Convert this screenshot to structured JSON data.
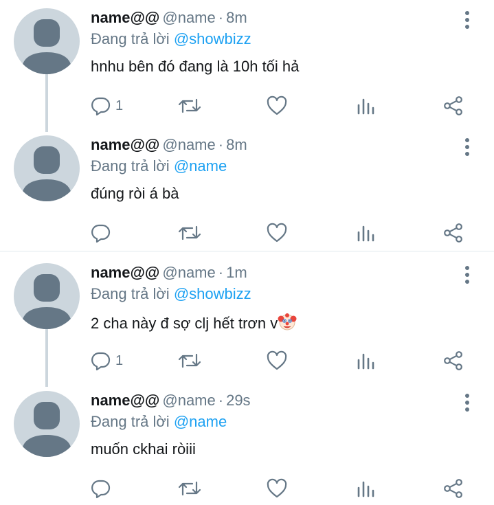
{
  "tweets": [
    {
      "name": "name@@",
      "handle": "@name",
      "time": "8m",
      "replying_prefix": "Đang trả lời",
      "replying_to": "@showbizz",
      "text": "hnhu bên đó đang là 10h tối hả",
      "reply_count": "1"
    },
    {
      "name": "name@@",
      "handle": "@name",
      "time": "8m",
      "replying_prefix": "Đang trả lời",
      "replying_to": "@name",
      "text": "đúng ròi á bà",
      "reply_count": ""
    },
    {
      "name": "name@@",
      "handle": "@name",
      "time": "1m",
      "replying_prefix": "Đang trả lời",
      "replying_to": "@showbizz",
      "text": "2 cha này đ sợ clj hết trơn v",
      "reply_count": "1"
    },
    {
      "name": "name@@",
      "handle": "@name",
      "time": "29s",
      "replying_prefix": "Đang trả lời",
      "replying_to": "@name",
      "text": "muốn ckhai ròiii",
      "reply_count": ""
    }
  ],
  "separator": "·",
  "icons": {
    "more": "more-vertical-icon",
    "reply": "reply-icon",
    "retweet": "retweet-icon",
    "like": "heart-icon",
    "analytics": "analytics-icon",
    "share": "share-icon",
    "emoji": "clown-face-emoji"
  },
  "colors": {
    "text": "#14171a",
    "secondary": "#657786",
    "mention": "#1da1f2",
    "avatar_bg": "#ccd6dd",
    "avatar_fg": "#657786"
  }
}
